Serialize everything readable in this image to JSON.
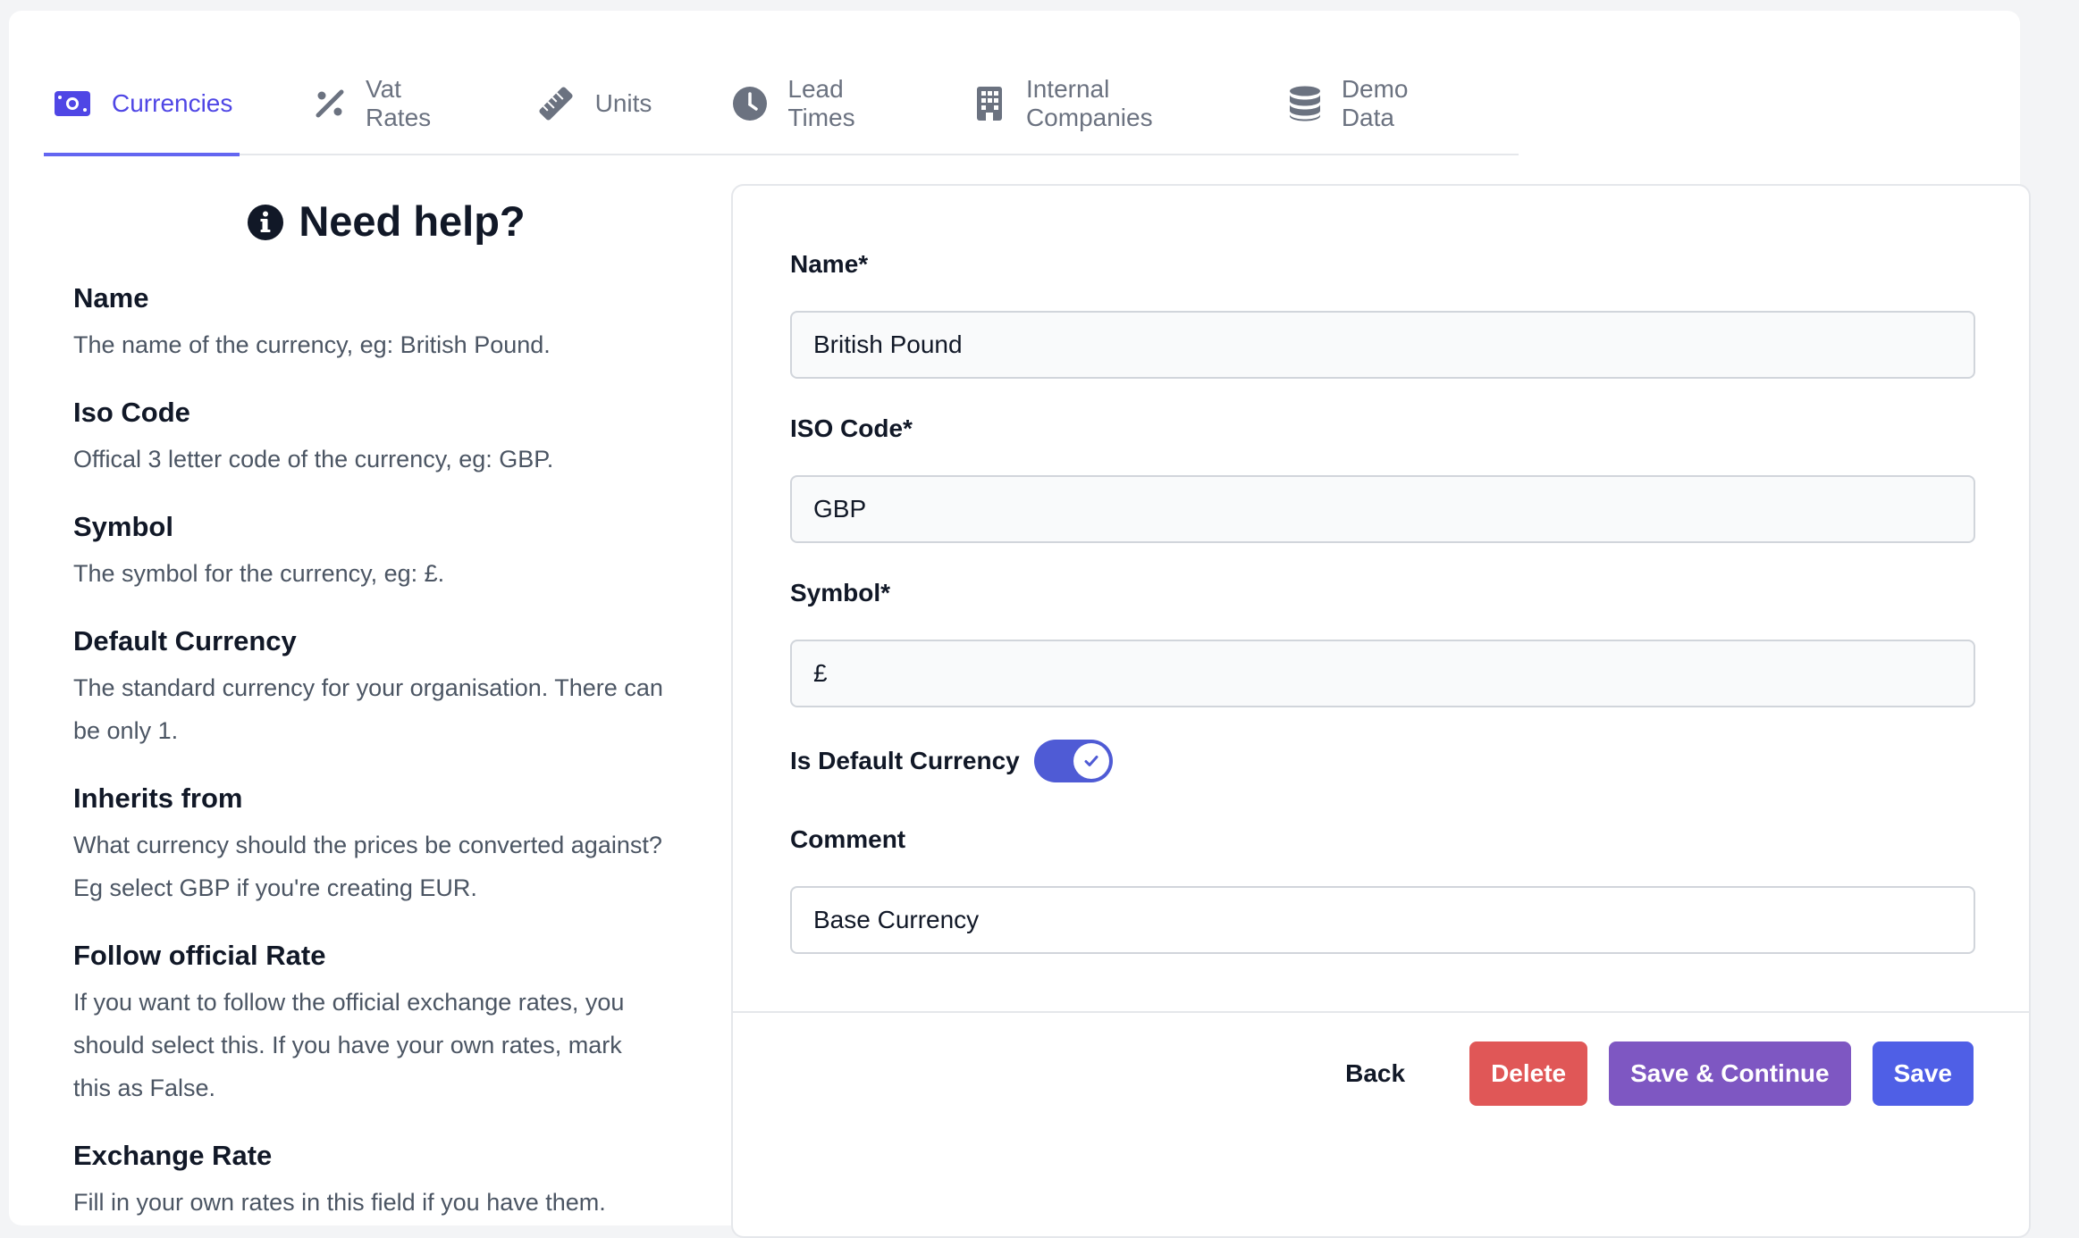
{
  "tabs": [
    {
      "label": "Currencies",
      "icon": "money-bill-icon",
      "active": true
    },
    {
      "label": "Vat Rates",
      "icon": "percent-icon",
      "active": false
    },
    {
      "label": "Units",
      "icon": "ruler-icon",
      "active": false
    },
    {
      "label": "Lead Times",
      "icon": "clock-icon",
      "active": false
    },
    {
      "label": "Internal Companies",
      "icon": "building-icon",
      "active": false
    },
    {
      "label": "Demo Data",
      "icon": "database-icon",
      "active": false
    }
  ],
  "help": {
    "title": "Need help?",
    "sections": [
      {
        "heading": "Name",
        "text": "The name of the currency, eg: British Pound."
      },
      {
        "heading": "Iso Code",
        "text": "Offical 3 letter code of the currency, eg: GBP."
      },
      {
        "heading": "Symbol",
        "text": "The symbol for the currency, eg: £."
      },
      {
        "heading": "Default Currency",
        "text": "The standard currency for your organisation. There can be only 1."
      },
      {
        "heading": "Inherits from",
        "text": "What currency should the prices be converted against? Eg select GBP if you're creating EUR."
      },
      {
        "heading": "Follow official Rate",
        "text": "If you want to follow the official exchange rates, you should select this. If you have your own rates, mark this as False."
      },
      {
        "heading": "Exchange Rate",
        "text": "Fill in your own rates in this field if you have them."
      }
    ]
  },
  "form": {
    "name_label": "Name*",
    "name_value": "British Pound",
    "iso_label": "ISO Code*",
    "iso_value": "GBP",
    "symbol_label": "Symbol*",
    "symbol_value": "£",
    "default_label": "Is Default Currency",
    "default_checked": true,
    "comment_label": "Comment",
    "comment_value": "Base Currency"
  },
  "actions": {
    "back": "Back",
    "delete": "Delete",
    "save_continue": "Save & Continue",
    "save": "Save"
  },
  "colors": {
    "accent": "#4f46e5",
    "delete": "#e05757",
    "save_continue": "#7e57c2",
    "save": "#4f5fe6",
    "toggle": "#4f5bd5"
  }
}
